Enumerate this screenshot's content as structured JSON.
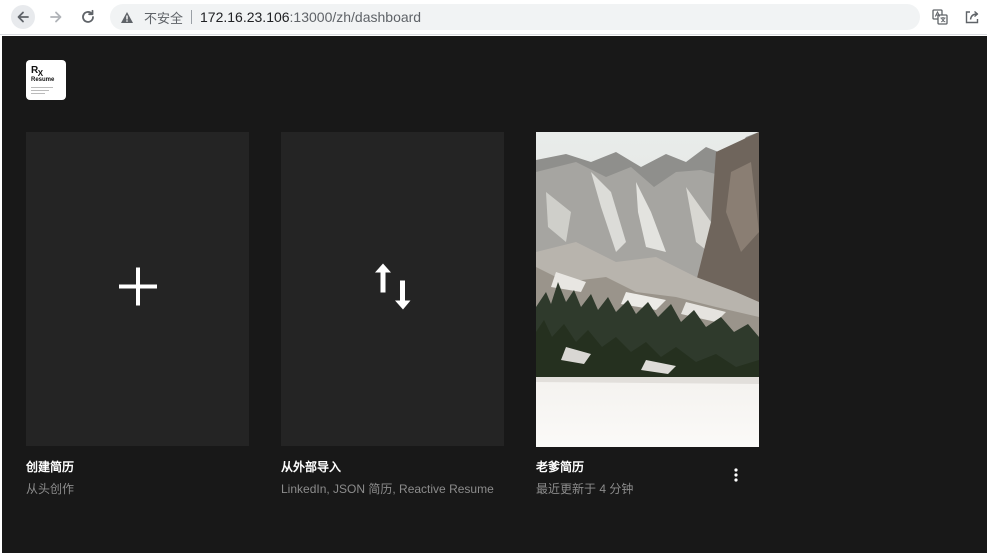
{
  "browser": {
    "insecure_label": "不安全",
    "url_host": "172.16.23.106",
    "url_rest": ":13000/zh/dashboard"
  },
  "logo": {
    "rx": "R",
    "rx_sub": "X",
    "word": "Resume"
  },
  "cards": [
    {
      "title": "创建简历",
      "subtitle": "从头创作",
      "icon": "plus-icon"
    },
    {
      "title": "从外部导入",
      "subtitle": "LinkedIn, JSON 简历, Reactive Resume",
      "icon": "arrows-up-down-icon"
    },
    {
      "title": "老爹简历",
      "subtitle": "最近更新于 4 分钟",
      "icon": "mountain-thumbnail"
    }
  ],
  "colors": {
    "app_bg": "#181818",
    "card_bg": "#242424",
    "muted_text": "#8c8c8c"
  }
}
